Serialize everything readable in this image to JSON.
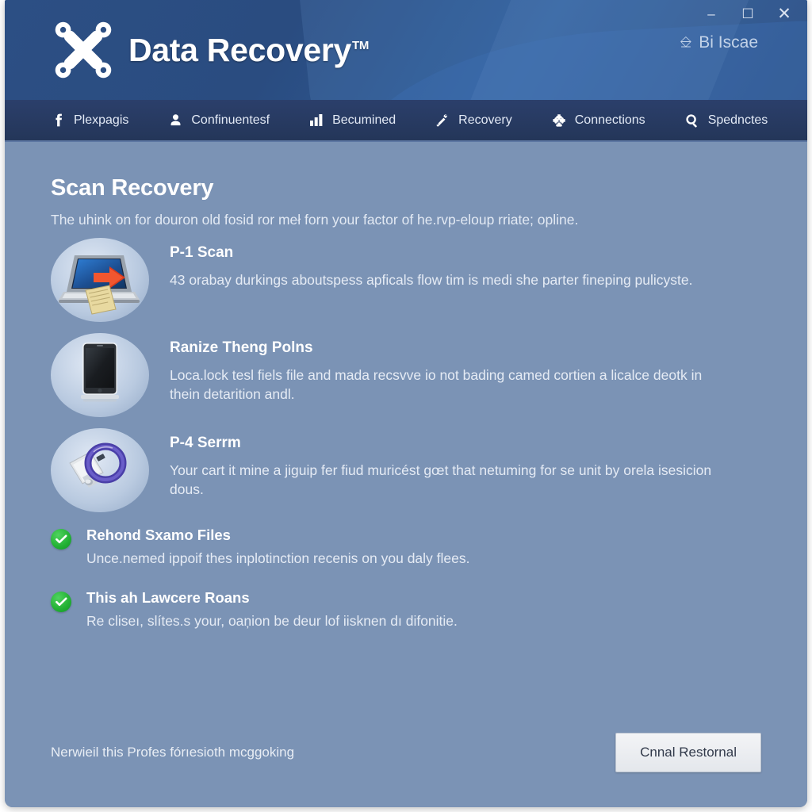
{
  "window": {
    "controls": {
      "minimize": "–",
      "maximize": "☐",
      "close": "✕"
    }
  },
  "header": {
    "brand": "Data Recovery",
    "trademark": "TM",
    "logo_icon": "crossed-tools-icon",
    "account": {
      "icon": "user-badge-icon",
      "label": "Bi Iscae"
    }
  },
  "nav": {
    "items": [
      {
        "icon": "facebook-icon",
        "label": "Plexpagis"
      },
      {
        "icon": "user-icon",
        "label": "Confinuentesf"
      },
      {
        "icon": "bar-chart-icon",
        "label": "Becumined"
      },
      {
        "icon": "tools-icon",
        "label": "Recovery"
      },
      {
        "icon": "puzzle-icon",
        "label": "Connections"
      },
      {
        "icon": "search-icon",
        "label": "Spednctes"
      }
    ]
  },
  "main": {
    "title": "Scan Recovery",
    "subtitle": "The uhink on for douron old fosid ror meł forn your factor of he.rvp-eloup rriate; opline.",
    "features": [
      {
        "icon": "laptop-transfer-icon",
        "title": "P-1 Scan",
        "desc": "43 orabay durkings aboutspess apficals flow tim is medi she parter fineping pulicyste."
      },
      {
        "icon": "tablet-device-icon",
        "title": "Ranize Theng Polns",
        "desc": "Loca.lock tesl fiels file and mada recsvve io not bading camed cortien a licalce deotk in thein detarition andl."
      },
      {
        "icon": "usb-drive-icon",
        "title": "P-4 Serrm",
        "desc": "Your cart it mine a jiguip fer fiud muricést gœt that netuming for se unit by orela isesicion dous."
      }
    ],
    "checks": [
      {
        "icon": "check-circle-icon",
        "title": "Rehond Sxamo Files",
        "desc": "Unce.nemed ippoif thes inplotinction recenis on you daly flees."
      },
      {
        "icon": "check-circle-icon",
        "title": "This ah Lawcere Roans",
        "desc": "Re cliseı, slítes.s your, oaņion be deur lof iisknen dı difonitie."
      }
    ]
  },
  "footer": {
    "note": "Nerwieil this Profes fórıesioth mcggoking",
    "action_label": "Cnnal Restornal"
  },
  "colors": {
    "header_blue": "#2c4f84",
    "nav_blue": "#2b3f6b",
    "body_blue": "#7b93b5",
    "check_green": "#22b033",
    "button_face": "#e9ecf1"
  }
}
